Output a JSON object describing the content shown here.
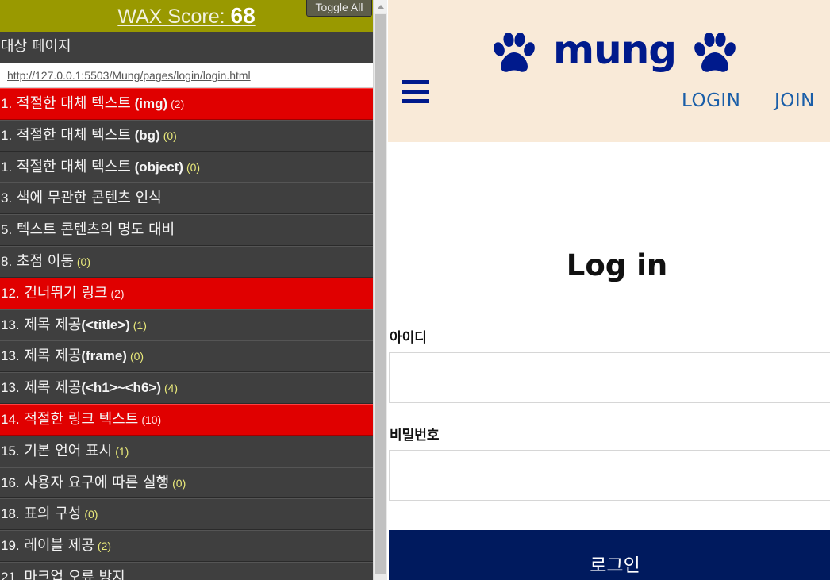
{
  "wax": {
    "score_label": "WAX Score:",
    "score_value": "68",
    "toggle_label": "Toggle All",
    "target_label": "대상 페이지",
    "target_url": "http://127.0.0.1:5503/Mung/pages/login/login.html",
    "fail_color": "#e00000",
    "header_color": "#999900",
    "items": [
      {
        "num": "1.",
        "name": "적절한 대체 텍스트",
        "suffix": " (img)",
        "count": "(2)",
        "status": "fail"
      },
      {
        "num": "1.",
        "name": "적절한 대체 텍스트",
        "suffix": " (bg)",
        "count": "(0)",
        "status": "pass"
      },
      {
        "num": "1.",
        "name": "적절한 대체 텍스트",
        "suffix": " (object)",
        "count": "(0)",
        "status": "pass"
      },
      {
        "num": "3.",
        "name": "색에 무관한 콘텐츠 인식",
        "suffix": "",
        "count": "",
        "status": "pass"
      },
      {
        "num": "5.",
        "name": "텍스트 콘텐츠의 명도 대비",
        "suffix": "",
        "count": "",
        "status": "pass"
      },
      {
        "num": "8.",
        "name": "초점 이동",
        "suffix": "",
        "count": "(0)",
        "status": "pass"
      },
      {
        "num": "12.",
        "name": "건너뛰기 링크",
        "suffix": "",
        "count": "(2)",
        "status": "fail"
      },
      {
        "num": "13.",
        "name": "제목 제공",
        "suffix": "(<title>)",
        "count": "(1)",
        "status": "pass"
      },
      {
        "num": "13.",
        "name": "제목 제공",
        "suffix": "(frame)",
        "count": "(0)",
        "status": "pass"
      },
      {
        "num": "13.",
        "name": "제목 제공",
        "suffix": "(<h1>~<h6>)",
        "count": "(4)",
        "status": "pass"
      },
      {
        "num": "14.",
        "name": "적절한 링크 텍스트",
        "suffix": "",
        "count": "(10)",
        "status": "fail"
      },
      {
        "num": "15.",
        "name": "기본 언어 표시",
        "suffix": "",
        "count": "(1)",
        "status": "pass"
      },
      {
        "num": "16.",
        "name": "사용자 요구에 따른 실행",
        "suffix": "",
        "count": "(0)",
        "status": "pass"
      },
      {
        "num": "18.",
        "name": "표의 구성",
        "suffix": "",
        "count": "(0)",
        "status": "pass"
      },
      {
        "num": "19.",
        "name": "레이블 제공",
        "suffix": "",
        "count": "(2)",
        "status": "pass"
      },
      {
        "num": "21.",
        "name": "마크업 오류 방지",
        "suffix": "",
        "count": "",
        "status": "pass"
      }
    ]
  },
  "site": {
    "logo_text": "mung",
    "logo_icon": "paw-icon",
    "brand_color": "#001a8c",
    "header_bg": "#f9ead8",
    "nav": {
      "login": "LOGIN",
      "join": "JOIN"
    },
    "heading": "Log in",
    "id_label": "아이디",
    "pw_label": "비밀번호",
    "login_button": "로그인",
    "button_color": "#001a5e"
  }
}
